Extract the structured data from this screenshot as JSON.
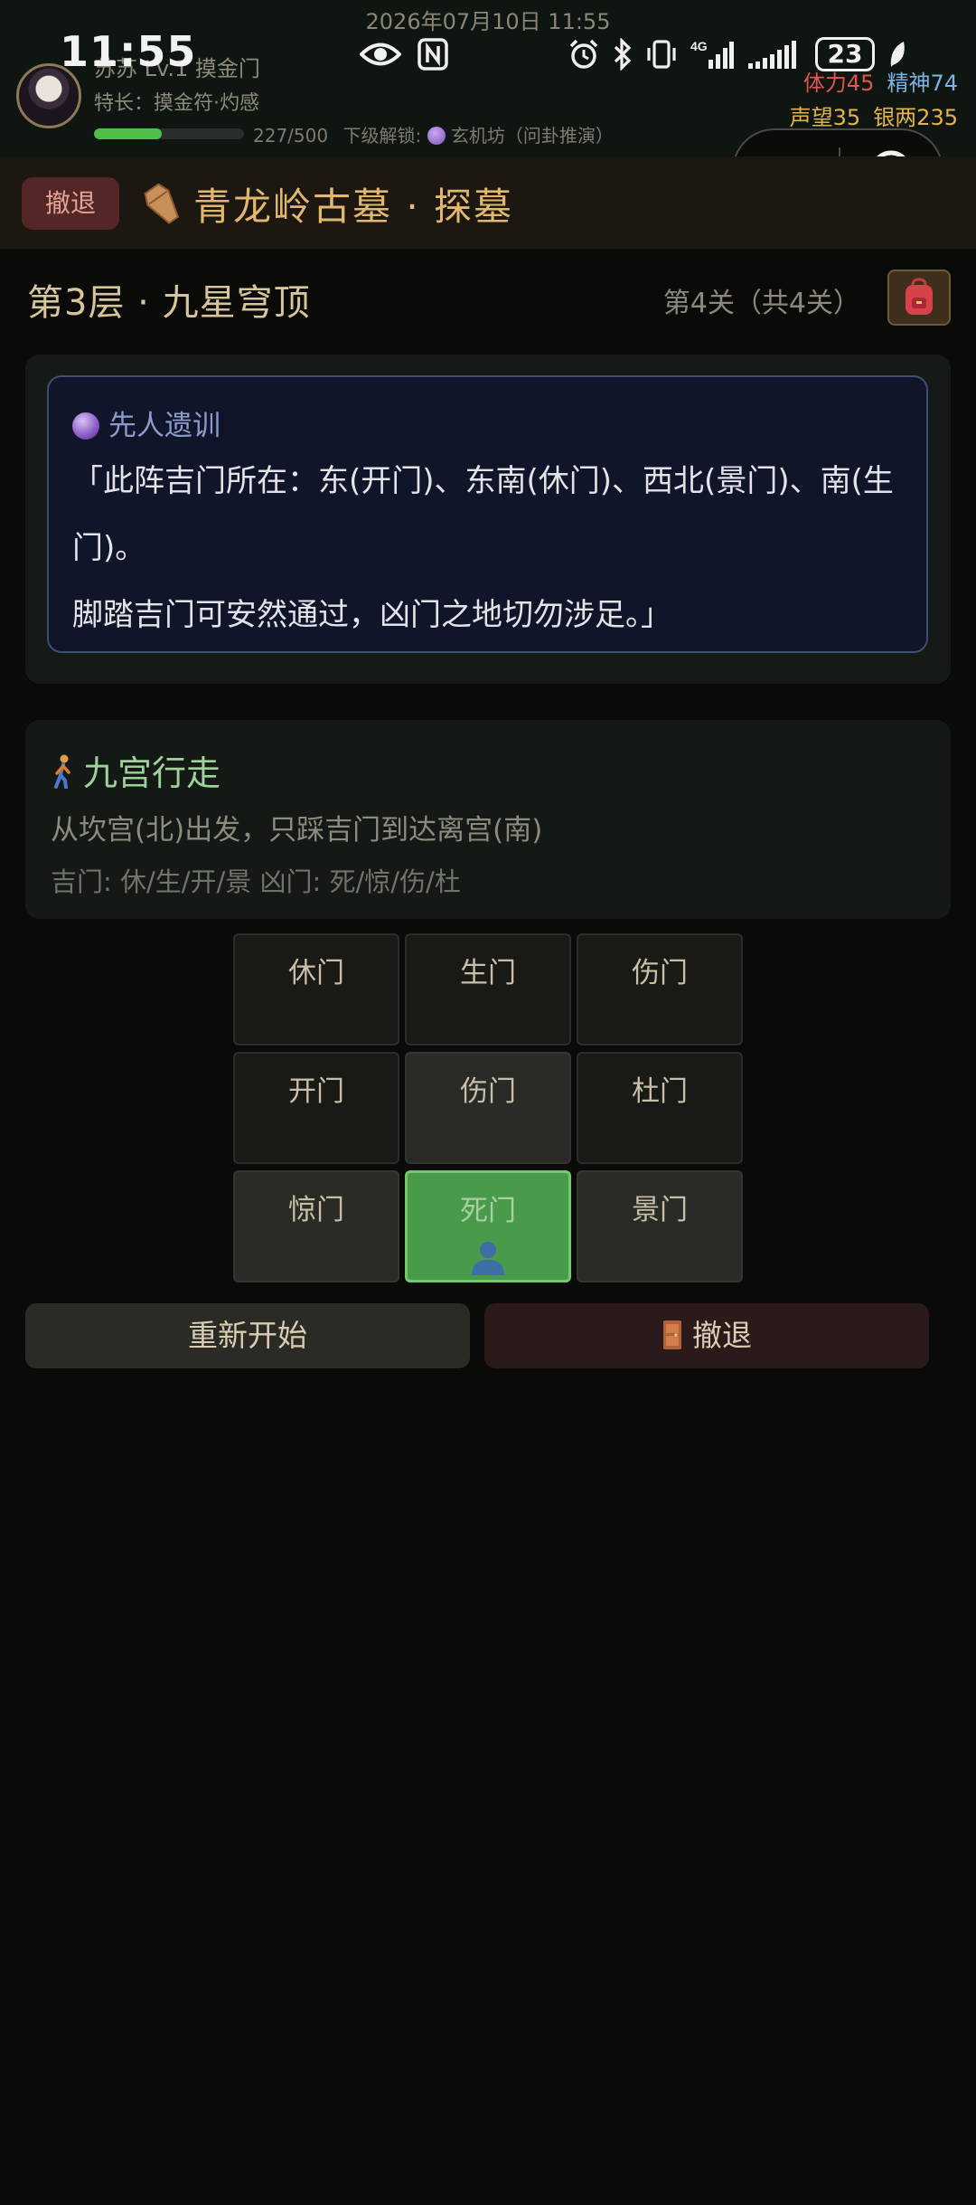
{
  "status_bar": {
    "watermark_date": "2026年07月10日 11:55",
    "time": "11:55",
    "battery": "23",
    "network": "4G"
  },
  "player": {
    "name_line": "苏苏 Lv.1 摸金门",
    "specialty": "特长：摸金符·灼感",
    "exp_text": "227/500",
    "exp_fraction": 0.454,
    "unlock_prefix": "下级解锁:",
    "unlock_text": "玄机坊（问卦推演）",
    "stamina": "体力45",
    "spirit": "精神74",
    "fame": "声望35",
    "silver": "银两235"
  },
  "header": {
    "retreat_label": "撤退",
    "title": "青龙岭古墓 · 探墓"
  },
  "floor": {
    "title": "第3层 · 九星穹顶",
    "stage": "第4关（共4关）"
  },
  "hint": {
    "title": "先人遗训",
    "text": "「此阵吉门所在：东(开门)、东南(休门)、西北(景门)、南(生门)。\n脚踏吉门可安然通过，凶门之地切勿涉足。」"
  },
  "puzzle": {
    "title": "九宫行走",
    "description": "从坎宫(北)出发，只踩吉门到达离宫(南)",
    "gates": "吉门: 休/生/开/景  凶门: 死/惊/伤/杜",
    "cells": [
      {
        "label": "休门",
        "state": "normal"
      },
      {
        "label": "生门",
        "state": "normal"
      },
      {
        "label": "伤门",
        "state": "normal"
      },
      {
        "label": "开门",
        "state": "normal"
      },
      {
        "label": "伤门",
        "state": "visited"
      },
      {
        "label": "杜门",
        "state": "normal"
      },
      {
        "label": "惊门",
        "state": "visited"
      },
      {
        "label": "死门",
        "state": "current"
      },
      {
        "label": "景门",
        "state": "visited"
      }
    ]
  },
  "actions": {
    "restart_label": "重新开始",
    "retreat_label": "撤退"
  },
  "colors": {
    "background": "#0a0a08",
    "accent_gold": "#e2b86e",
    "current_cell": "#4a9a4c",
    "stamina": "#e0554d",
    "spirit": "#7fb3e6"
  }
}
